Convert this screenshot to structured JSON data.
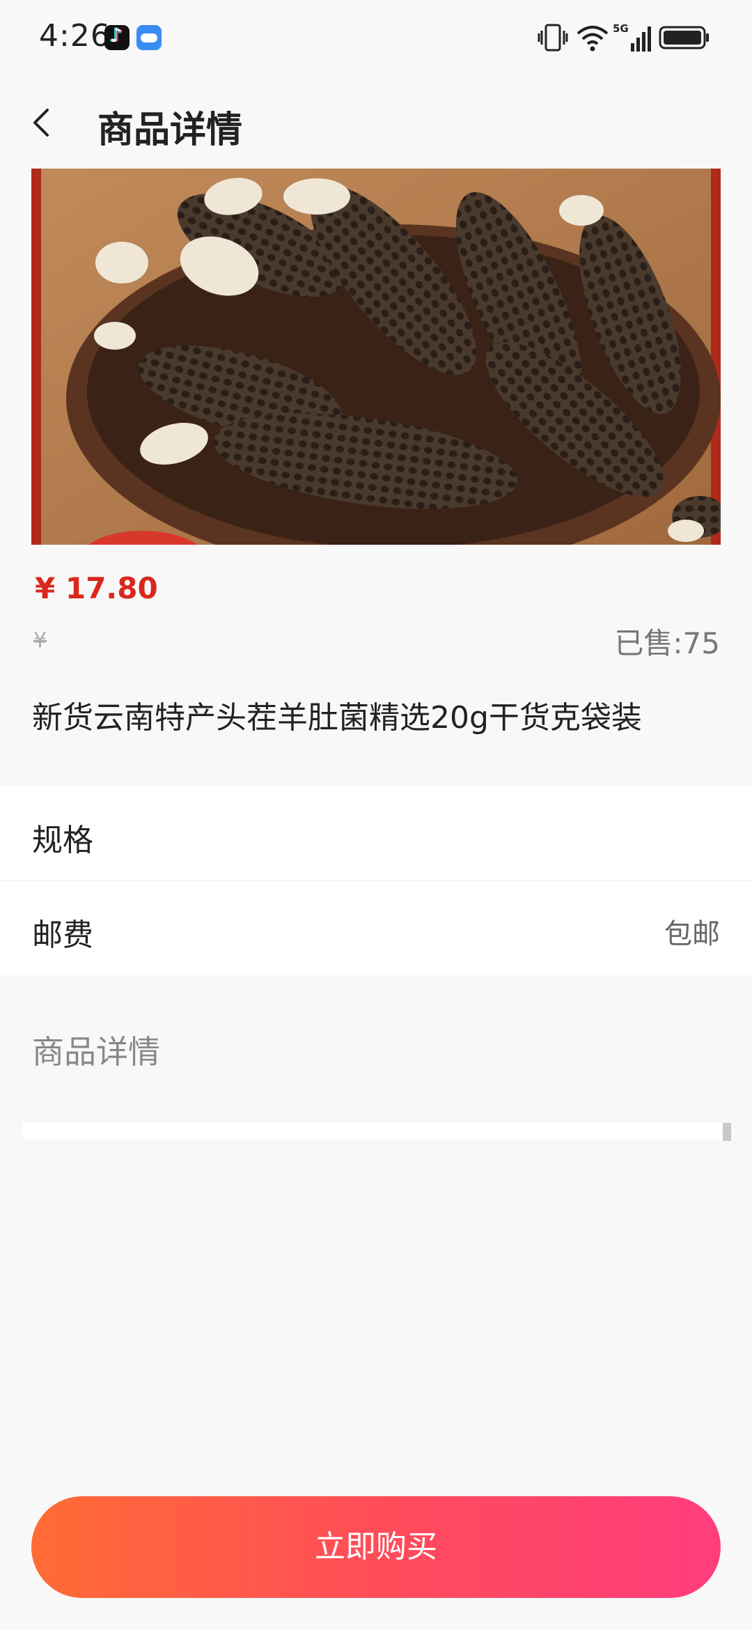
{
  "status_bar": {
    "time": "4:26",
    "network": "5G"
  },
  "header": {
    "title": "商品详情"
  },
  "product": {
    "image": "morel-mushrooms-product-photo",
    "price": "¥ 17.80",
    "original_price": "¥",
    "sold": "已售:75",
    "title": "新货云南特产头茬羊肚菌精选20g干货克袋装"
  },
  "options": {
    "spec_label": "规格",
    "shipping_label": "邮费",
    "shipping_value": "包邮"
  },
  "detail": {
    "heading": "商品详情"
  },
  "buy_button": {
    "label": "立即购买"
  },
  "colors": {
    "price": "#d8281e",
    "button_start": "#ff6b35",
    "button_end": "#ff3d7d"
  }
}
